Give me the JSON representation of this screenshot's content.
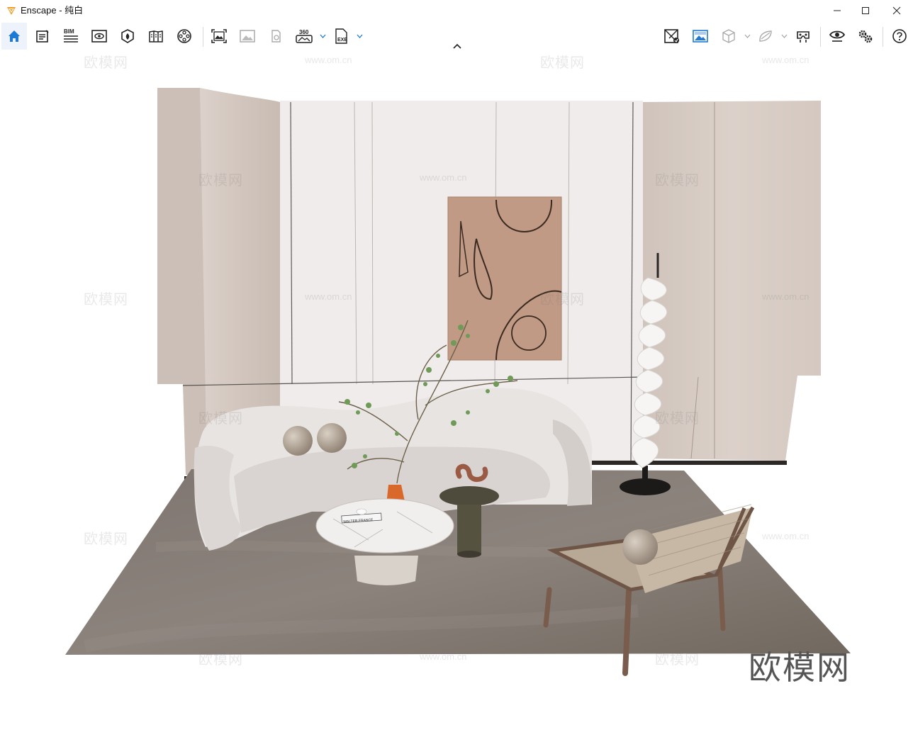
{
  "window": {
    "title": "Enscape - 纯白",
    "buttons": {
      "minimize": "minimize",
      "maximize": "maximize",
      "close": "close"
    }
  },
  "toolbar": {
    "left": [
      {
        "name": "home-icon",
        "label": "home",
        "active": true
      },
      {
        "name": "notes-icon",
        "label": "notes"
      },
      {
        "name": "bim-icon",
        "label": "BIM"
      },
      {
        "name": "visual-settings-icon",
        "label": "view"
      },
      {
        "name": "asset-library-icon",
        "label": "assets"
      },
      {
        "name": "material-editor-icon",
        "label": "materials"
      },
      {
        "name": "video-editor-icon",
        "label": "video"
      },
      {
        "name": "screenshot-icon",
        "label": "screenshot"
      },
      {
        "name": "gallery-icon",
        "label": "gallery"
      },
      {
        "name": "batch-render-icon",
        "label": "batch"
      },
      {
        "name": "panorama-360-icon",
        "label": "360"
      },
      {
        "name": "exe-export-icon",
        "label": "EXE"
      }
    ],
    "bim_label": "BIM",
    "pano_label": "360",
    "exe_label": "EXE",
    "right": [
      {
        "name": "sync-views-icon"
      },
      {
        "name": "live-update-icon",
        "active": true
      },
      {
        "name": "orthographic-icon"
      },
      {
        "name": "vr-headset-icon"
      },
      {
        "name": "capture-icon"
      },
      {
        "name": "view-eye-icon"
      },
      {
        "name": "settings-gears-icon"
      },
      {
        "name": "help-icon"
      }
    ],
    "accent_color": "#1f7ad6"
  },
  "viewport": {
    "watermark_cn": "欧模网",
    "watermark_url": "www.om.cn",
    "brand_mark": "欧模网",
    "book_text": "WALTER FRANCE"
  }
}
